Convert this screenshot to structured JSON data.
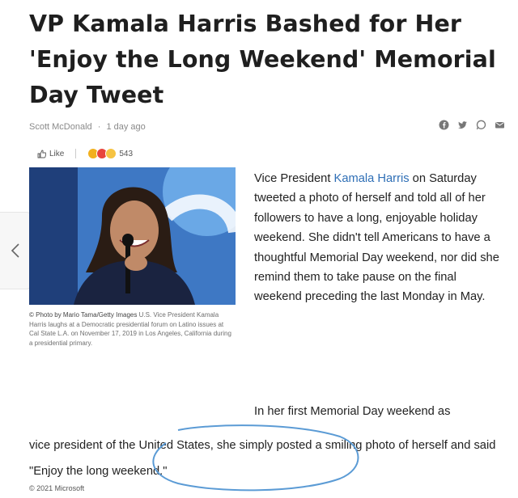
{
  "article": {
    "title": "VP Kamala Harris Bashed for Her 'Enjoy the Long Weekend' Memorial Day Tweet",
    "author": "Scott McDonald",
    "time": "1 day ago",
    "like_label": "Like",
    "reaction_count": "543"
  },
  "share_icons": [
    "facebook-icon",
    "twitter-icon",
    "whatsapp-icon",
    "email-icon"
  ],
  "photo": {
    "credit": "© Photo by Mario Tama/Getty Images",
    "caption": "U.S. Vice President Kamala Harris laughs at a Democratic presidential forum on Latino issues at Cal State L.A. on November 17, 2019 in Los Angeles, California during a presidential primary."
  },
  "paragraph1": {
    "prefix": "Vice President ",
    "link": "Kamala Harris",
    "rest": " on Saturday tweeted a photo of herself and told all of her followers to have a long, enjoyable holiday weekend. She didn't tell Americans to have a thoughtful Memorial Day weekend, nor did she remind them to take pause on the final weekend preceding the last Monday in May."
  },
  "paragraph2": {
    "line1": "In her first Memorial Day weekend as",
    "rest": "vice president of the United States, she simply posted a smiling photo of herself and said \"Enjoy the long weekend.\""
  },
  "footer": "© 2021 Microsoft",
  "colors": {
    "link": "#2f6fb6",
    "annotation": "#5b9bd5"
  }
}
